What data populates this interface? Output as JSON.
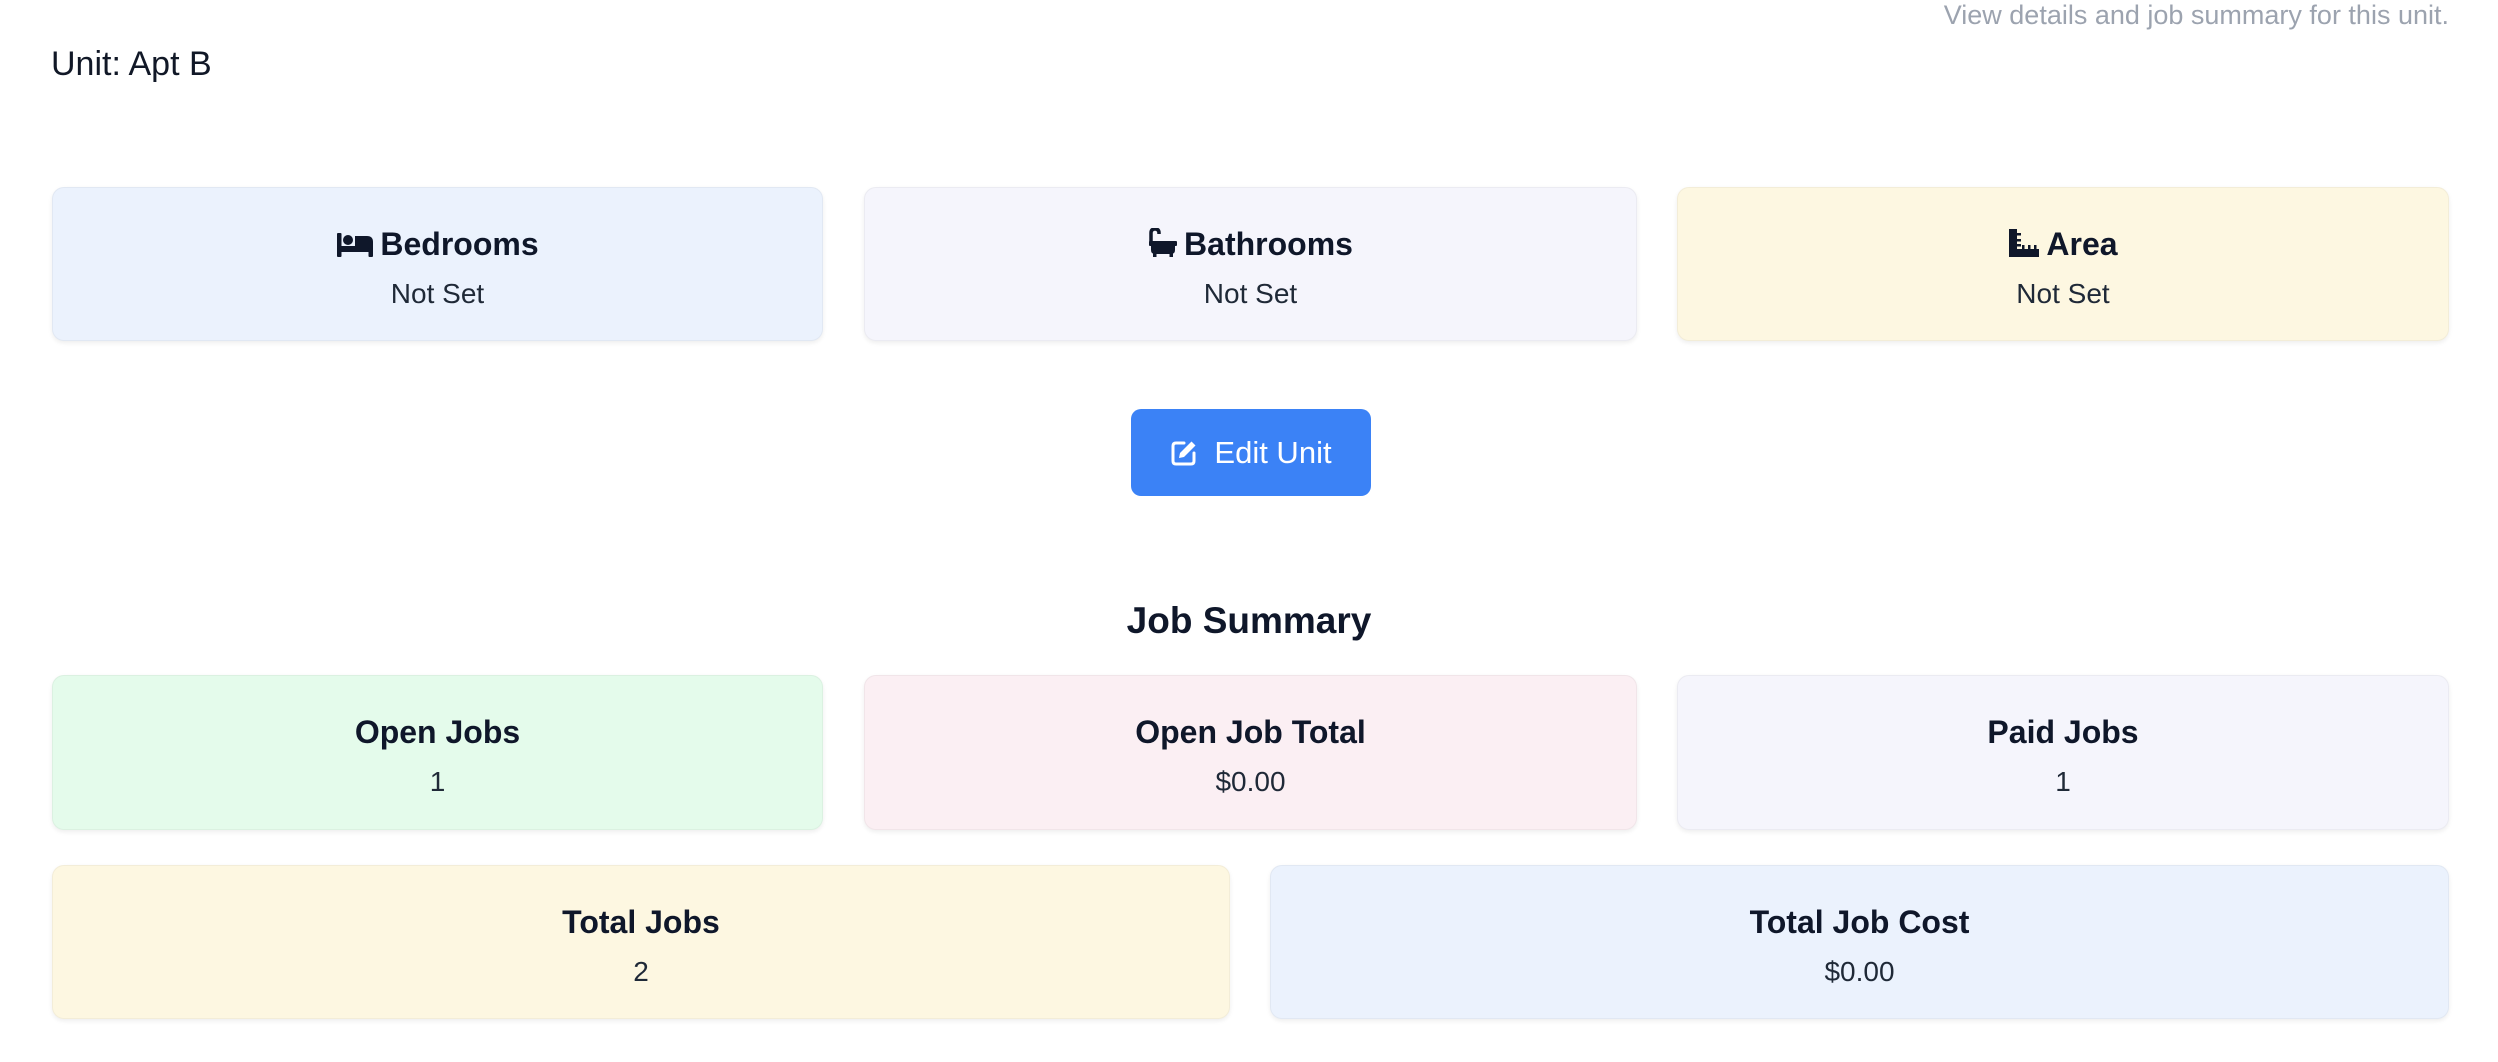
{
  "header": {
    "subtitle": "View details and job summary for this unit.",
    "title": "Unit: Apt B"
  },
  "unit_details": {
    "bedrooms": {
      "label": "Bedrooms",
      "value": "Not Set",
      "icon": "bed-icon",
      "bg": "#ebf2fd"
    },
    "bathrooms": {
      "label": "Bathrooms",
      "value": "Not Set",
      "icon": "bath-icon",
      "bg": "#f5f5fc"
    },
    "area": {
      "label": "Area",
      "value": "Not Set",
      "icon": "ruler-icon",
      "bg": "#fdf7e1"
    }
  },
  "actions": {
    "edit_label": "Edit Unit",
    "edit_icon": "edit-icon",
    "accent": "#3b82f6"
  },
  "job_summary": {
    "title": "Job Summary",
    "open_jobs": {
      "label": "Open Jobs",
      "value": "1",
      "bg": "#e4fbeb"
    },
    "open_job_total": {
      "label": "Open Job Total",
      "value": "$0.00",
      "bg": "#fbeff3"
    },
    "paid_jobs": {
      "label": "Paid Jobs",
      "value": "1",
      "bg": "#f5f5fc"
    },
    "total_jobs": {
      "label": "Total Jobs",
      "value": "2",
      "bg": "#fdf7e1"
    },
    "total_job_cost": {
      "label": "Total Job Cost",
      "value": "$0.00",
      "bg": "#ebf2fd"
    }
  }
}
